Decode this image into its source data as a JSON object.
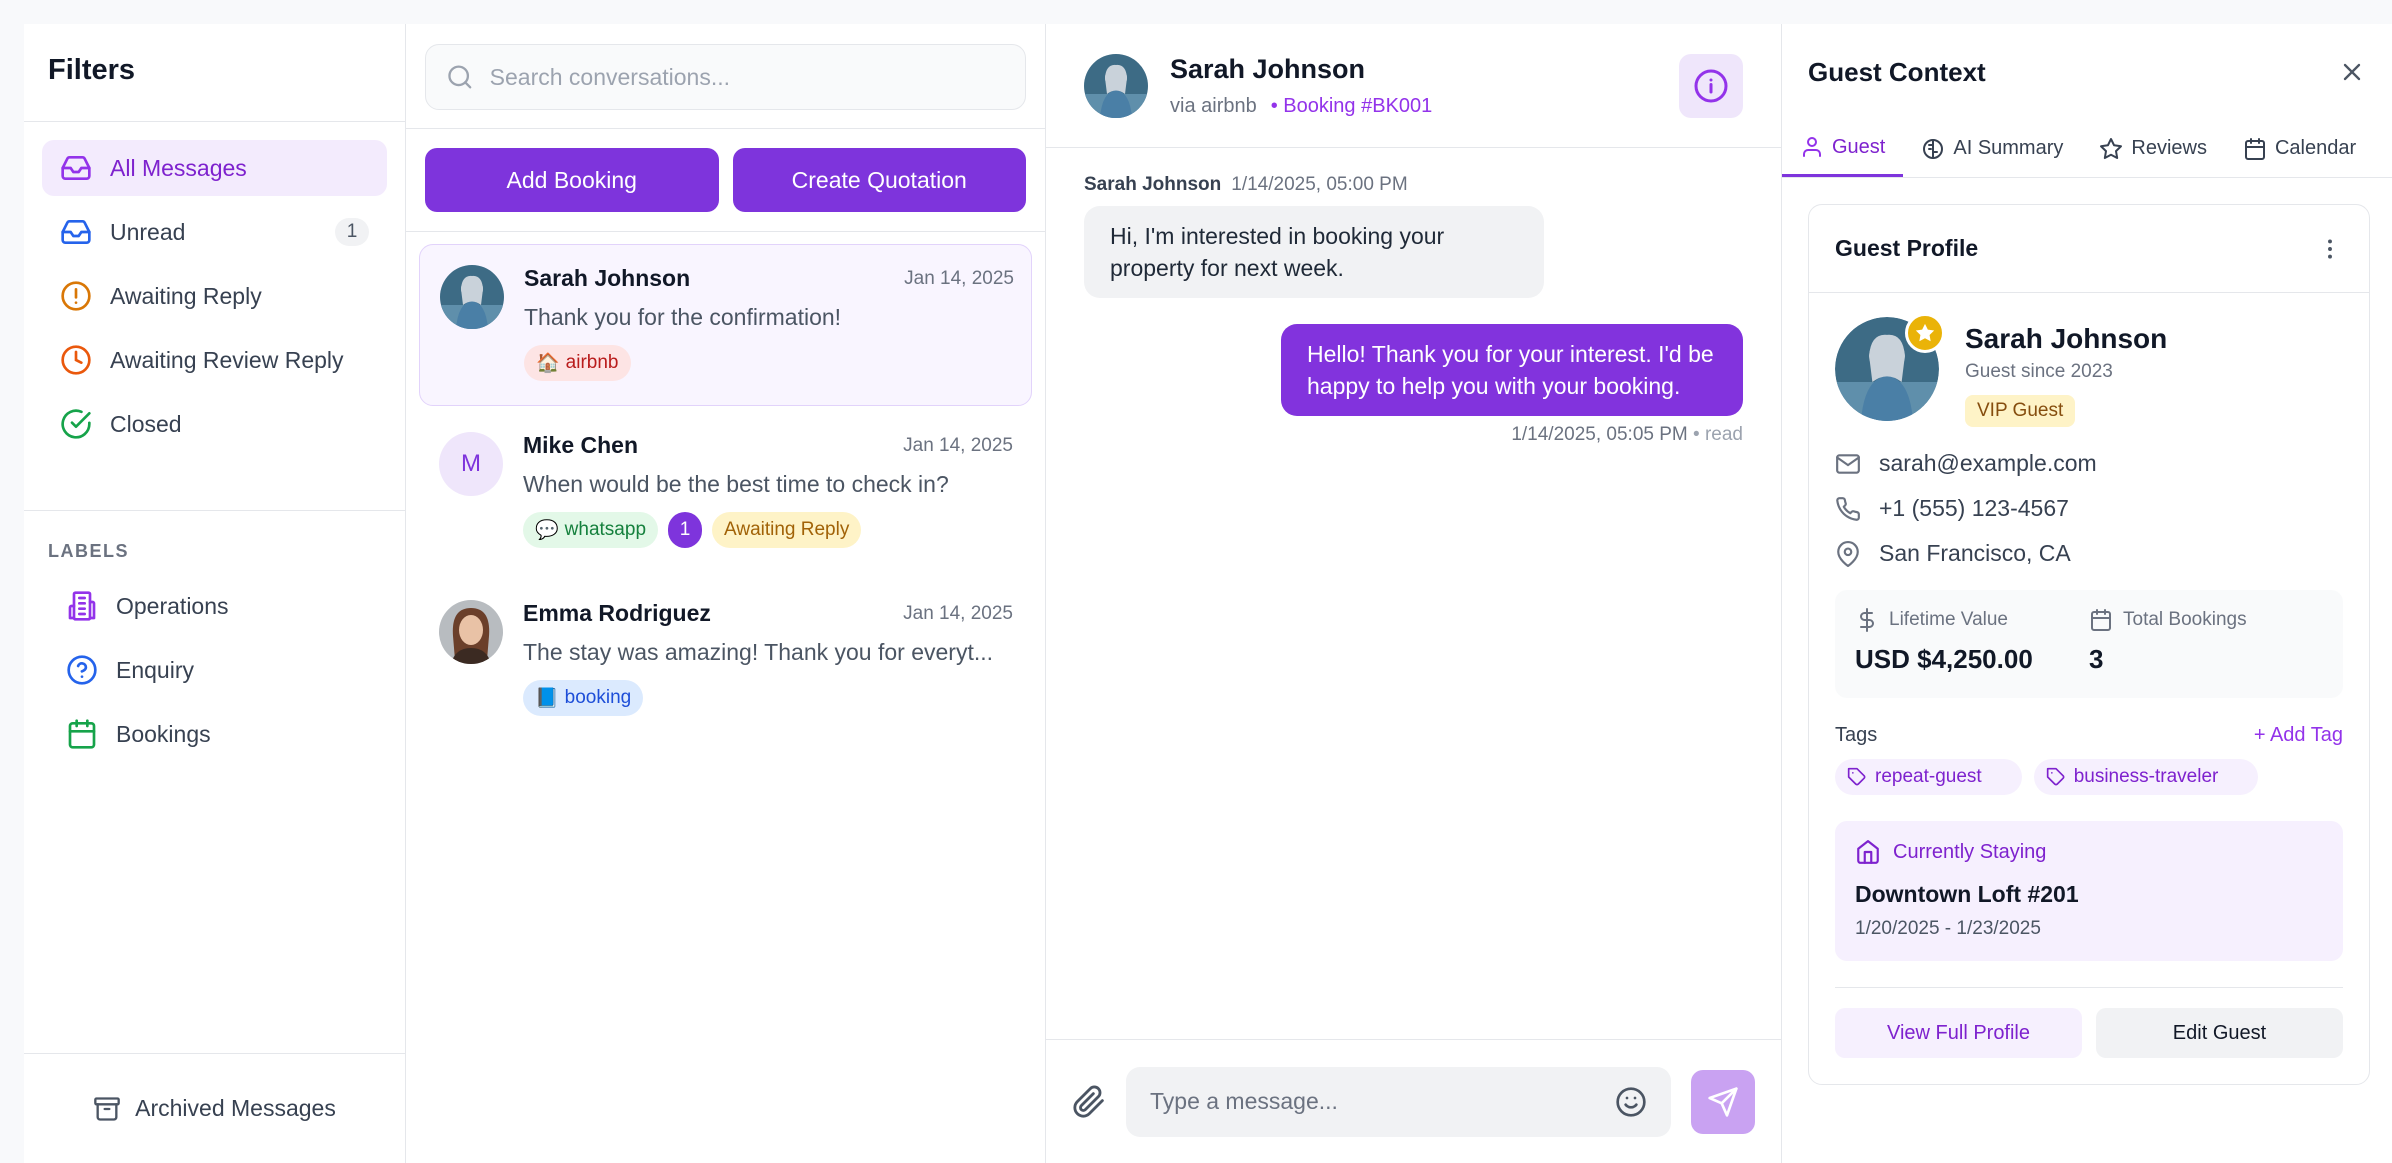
{
  "filters": {
    "title": "Filters",
    "items": [
      {
        "label": "All Messages",
        "icon": "inbox-icon"
      },
      {
        "label": "Unread",
        "icon": "inbox-icon",
        "count": "1"
      },
      {
        "label": "Awaiting Reply",
        "icon": "alert-circle-icon"
      },
      {
        "label": "Awaiting Review Reply",
        "icon": "clock-icon"
      },
      {
        "label": "Closed",
        "icon": "check-circle-icon"
      }
    ],
    "labels_title": "LABELS",
    "labels": [
      {
        "label": "Operations",
        "icon": "building-icon"
      },
      {
        "label": "Enquiry",
        "icon": "help-circle-icon"
      },
      {
        "label": "Bookings",
        "icon": "calendar-icon"
      }
    ],
    "archived": "Archived Messages"
  },
  "conversations": {
    "search_placeholder": "Search conversations...",
    "add_booking": "Add Booking",
    "create_quotation": "Create Quotation",
    "items": [
      {
        "name": "Sarah Johnson",
        "date": "Jan 14, 2025",
        "message": "Thank you for the confirmation!",
        "chip": "airbnb"
      },
      {
        "initial": "M",
        "name": "Mike Chen",
        "date": "Jan 14, 2025",
        "message": "When would be the best time to check in?",
        "chip": "whatsapp",
        "unread": "1",
        "status": "Awaiting Reply"
      },
      {
        "name": "Emma Rodriguez",
        "date": "Jan 14, 2025",
        "message": "The stay was amazing! Thank you for everyt...",
        "chip": "booking"
      }
    ]
  },
  "chat": {
    "name": "Sarah Johnson",
    "via": "via airbnb",
    "booking": "• Booking #BK001",
    "incoming": {
      "sender": "Sarah Johnson",
      "time": "1/14/2025, 05:00 PM",
      "text": "Hi, I'm interested in booking your property for next week."
    },
    "outgoing": {
      "time": "1/14/2025, 05:05 PM",
      "status": "• read",
      "text": "Hello! Thank you for your interest. I'd be happy to help you with your booking."
    },
    "composer_placeholder": "Type a message..."
  },
  "guest": {
    "title": "Guest Context",
    "tabs": [
      {
        "label": "Guest",
        "icon": "user-icon"
      },
      {
        "label": "AI Summary",
        "icon": "brain-icon"
      },
      {
        "label": "Reviews",
        "icon": "star-icon"
      },
      {
        "label": "Calendar",
        "icon": "calendar-icon"
      }
    ],
    "profile_title": "Guest Profile",
    "name": "Sarah Johnson",
    "since": "Guest since 2023",
    "vip": "VIP Guest",
    "email": "sarah@example.com",
    "phone": "+1 (555) 123-4567",
    "location": "San Francisco, CA",
    "lifetime_label": "Lifetime Value",
    "lifetime_value": "USD $4,250.00",
    "bookings_label": "Total Bookings",
    "bookings_value": "3",
    "tags_label": "Tags",
    "add_tag": "+ Add Tag",
    "tags": [
      "repeat-guest",
      "business-traveler"
    ],
    "staying_label": "Currently Staying",
    "property": "Downtown Loft #201",
    "dates": "1/20/2025 - 1/23/2025",
    "view_profile": "View Full Profile",
    "edit_guest": "Edit Guest"
  },
  "colors": {
    "accent": "#7e34dc",
    "accent_soft": "#f3ebfd"
  }
}
